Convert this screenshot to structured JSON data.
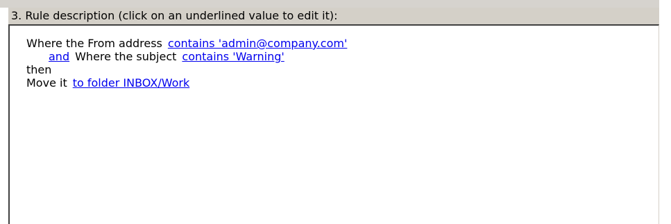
{
  "heading": "3. Rule description (click on an underlined value to edit it):",
  "rule": {
    "condition1_text": "Where the From address",
    "condition1_value": "contains 'admin@company.com'",
    "conjunction": "and",
    "condition2_text": "Where the subject",
    "condition2_value": "contains 'Warning'",
    "then_text": "then",
    "action_text": "Move it",
    "action_value": "to folder INBOX/Work"
  },
  "colors": {
    "link": "#0000ee",
    "panel_bg": "#d4d0c8",
    "box_bg": "#ffffff"
  }
}
